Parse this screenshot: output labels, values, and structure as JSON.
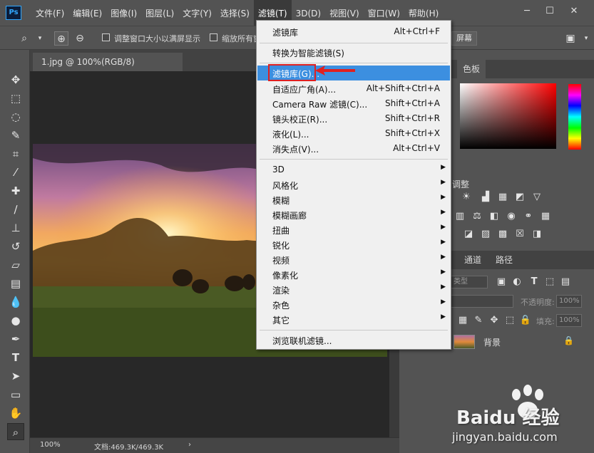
{
  "app": {
    "logo": "Ps"
  },
  "menubar": {
    "items": [
      "文件(F)",
      "编辑(E)",
      "图像(I)",
      "图层(L)",
      "文字(Y)",
      "选择(S)",
      "滤镜(T)",
      "3D(D)",
      "视图(V)",
      "窗口(W)",
      "帮助(H)"
    ],
    "active_index": 6
  },
  "options": {
    "resize_label": "调整窗口大小以满屏显示",
    "zoom_all_label": "缩放所有窗",
    "fill_screen": "屏幕"
  },
  "document": {
    "tab_title": "1.jpg @ 100%(RGB/8)",
    "zoom": "100%",
    "doc_info": "文档:469.3K/469.3K"
  },
  "panels": {
    "color_tab": "色板",
    "adjustments_label": "调整",
    "tabs": [
      "通道",
      "路径"
    ],
    "kind_label": "类型",
    "opacity_label": "不透明度:",
    "opacity_value": "100%",
    "fill_label": "填充:",
    "fill_value": "100%",
    "layer_name": "背景"
  },
  "filter_menu": {
    "items": [
      {
        "label": "滤镜库",
        "shortcut": "Alt+Ctrl+F"
      },
      {
        "label": "转换为智能滤镜(S)",
        "shortcut": ""
      },
      {
        "label": "滤镜库(G)...",
        "shortcut": "",
        "highlighted": true
      },
      {
        "label": "自适应广角(A)...",
        "shortcut": "Alt+Shift+Ctrl+A"
      },
      {
        "label": "Camera Raw 滤镜(C)...",
        "shortcut": "Shift+Ctrl+A"
      },
      {
        "label": "镜头校正(R)...",
        "shortcut": "Shift+Ctrl+R"
      },
      {
        "label": "液化(L)...",
        "shortcut": "Shift+Ctrl+X"
      },
      {
        "label": "消失点(V)...",
        "shortcut": "Alt+Ctrl+V"
      },
      {
        "label": "3D",
        "submenu": true
      },
      {
        "label": "风格化",
        "submenu": true
      },
      {
        "label": "模糊",
        "submenu": true
      },
      {
        "label": "模糊画廊",
        "submenu": true
      },
      {
        "label": "扭曲",
        "submenu": true
      },
      {
        "label": "锐化",
        "submenu": true
      },
      {
        "label": "视频",
        "submenu": true
      },
      {
        "label": "像素化",
        "submenu": true
      },
      {
        "label": "渲染",
        "submenu": true
      },
      {
        "label": "杂色",
        "submenu": true
      },
      {
        "label": "其它",
        "submenu": true
      },
      {
        "label": "浏览联机滤镜..."
      }
    ],
    "highlight_color": "#3c8fe0"
  },
  "watermark": {
    "brand": "Baidu 经验",
    "url": "jingyan.baidu.com"
  }
}
